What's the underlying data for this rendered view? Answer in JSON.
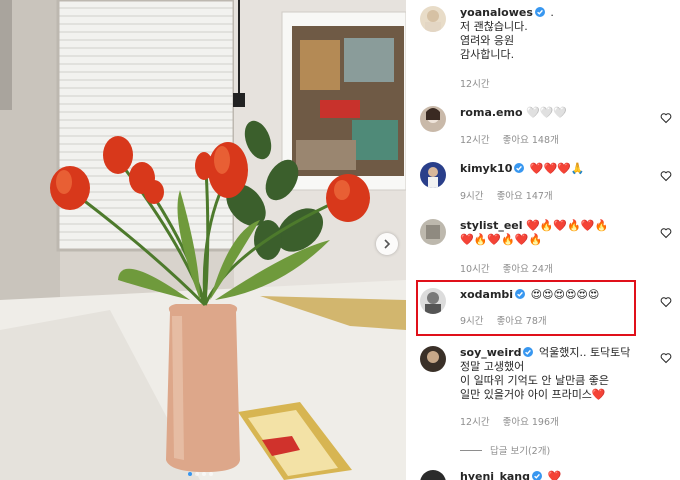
{
  "post_photo": {
    "alt": "tulips in a vase on a table",
    "carousel_dots": 4,
    "active_dot": 0
  },
  "comments": [
    {
      "username": "yoanalowes",
      "verified": true,
      "text_lines": [
        ".",
        "저 괜찮습니다.",
        "염려와 응원",
        "감사합니다."
      ],
      "time": "12시간",
      "likes": "",
      "has_like_button": false
    },
    {
      "username": "roma.emo",
      "verified": false,
      "text_lines": [
        "🤍🤍🤍"
      ],
      "time": "12시간",
      "likes": "좋아요 148개",
      "has_like_button": true
    },
    {
      "username": "kimyk10",
      "verified": true,
      "text_lines": [
        "❤️❤️❤️🙏"
      ],
      "time": "9시간",
      "likes": "좋아요 147개",
      "has_like_button": true
    },
    {
      "username": "stylist_eel",
      "verified": false,
      "text_lines": [
        "❤️🔥❤️🔥❤️🔥",
        "❤️🔥❤️🔥❤️🔥"
      ],
      "time": "10시간",
      "likes": "좋아요 24개",
      "has_like_button": true
    },
    {
      "username": "xodambi",
      "verified": true,
      "text_lines": [
        "😍😍😍😍😍😍"
      ],
      "time": "9시간",
      "likes": "좋아요 78개",
      "has_like_button": true
    },
    {
      "username": "soy_weird",
      "verified": true,
      "text_lines": [
        "억울했지.. 토닥토닥",
        "정말 고생했어",
        "이 일따위 기억도 안 날만큼 좋은",
        "일만 있을거야 아이 프라미스❤️"
      ],
      "time": "12시간",
      "likes": "좋아요 196개",
      "has_like_button": true
    },
    {
      "username": "hyeni_kang",
      "verified": true,
      "text_lines": [
        "❤️"
      ],
      "time": "",
      "likes": "",
      "has_like_button": false
    }
  ],
  "view_replies_label": "답글 보기(2개)",
  "colors": {
    "verified": "#3897f0",
    "highlight_box": "#e0101a",
    "meta_text": "#8e8e8e"
  },
  "icons": [
    "verified-badge-icon",
    "heart-outline-icon",
    "chevron-right-icon"
  ]
}
